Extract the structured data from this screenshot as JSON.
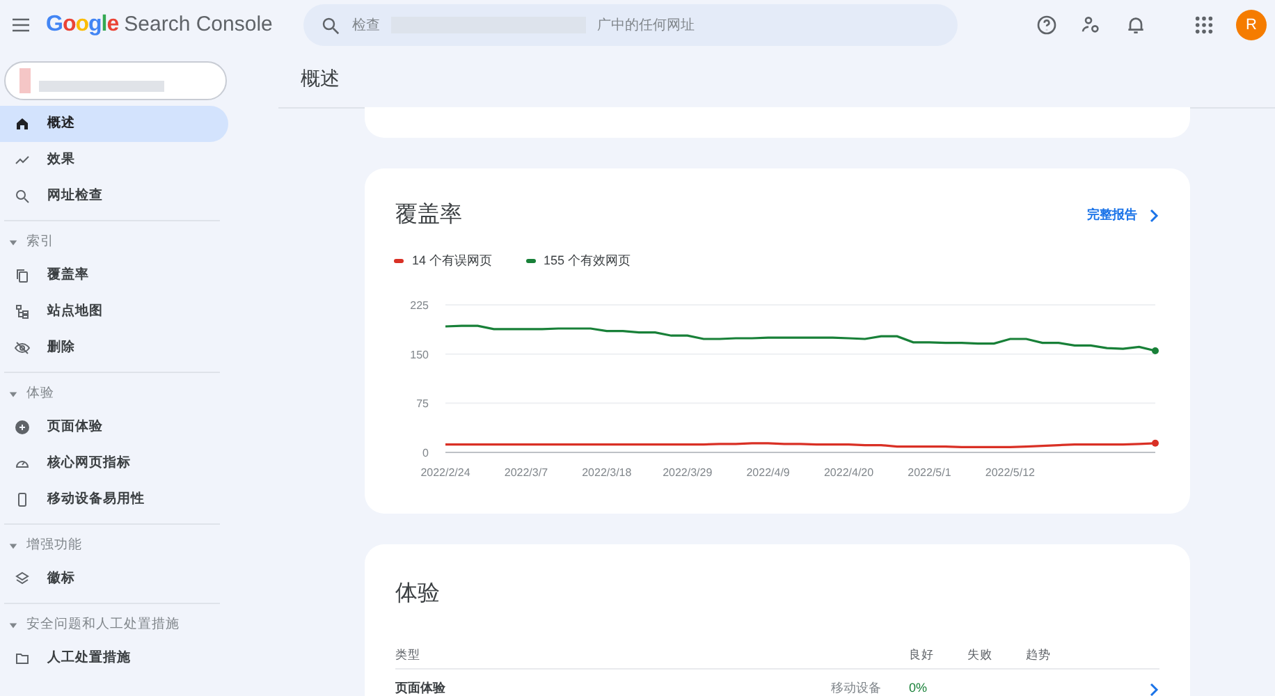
{
  "header": {
    "logo_word": "Google",
    "product": "Search Console",
    "search": {
      "placeholder_start": "检查",
      "placeholder_end": "广中的任何网址"
    },
    "avatar": "R"
  },
  "page_title": "概述",
  "sidebar": [
    {
      "kind": "item",
      "label": "概述",
      "selected": true
    },
    {
      "kind": "item",
      "label": "效果",
      "selected": false
    },
    {
      "kind": "item",
      "label": "网址检查",
      "selected": false
    },
    {
      "kind": "section",
      "label": "索引",
      "expanded": true
    },
    {
      "kind": "item",
      "label": "覆盖率",
      "selected": false
    },
    {
      "kind": "item",
      "label": "站点地图",
      "selected": false
    },
    {
      "kind": "item",
      "label": "删除",
      "selected": false
    },
    {
      "kind": "section",
      "label": "体验",
      "expanded": true
    },
    {
      "kind": "item",
      "label": "页面体验",
      "selected": false
    },
    {
      "kind": "item",
      "label": "核心网页指标",
      "selected": false
    },
    {
      "kind": "item",
      "label": "移动设备易用性",
      "selected": false
    },
    {
      "kind": "section",
      "label": "增强功能",
      "expanded": true
    },
    {
      "kind": "item",
      "label": "徽标",
      "selected": false
    },
    {
      "kind": "section",
      "label": "安全问题和人工处置措施",
      "expanded": true
    },
    {
      "kind": "item",
      "label": "人工处置措施",
      "selected": false
    }
  ],
  "coverage": {
    "title": "覆盖率",
    "link": "完整报告",
    "chart_data": {
      "type": "line",
      "categories": [
        "2022/2/24",
        null,
        null,
        null,
        null,
        "2022/3/7",
        null,
        null,
        null,
        null,
        "2022/3/18",
        null,
        null,
        null,
        null,
        "2022/3/29",
        null,
        null,
        null,
        null,
        "2022/4/9",
        null,
        null,
        null,
        null,
        "2022/4/20",
        null,
        null,
        null,
        null,
        "2022/5/1",
        null,
        null,
        null,
        null,
        "2022/5/12",
        null,
        null,
        null,
        null,
        null,
        null,
        null,
        null,
        null
      ],
      "series": [
        {
          "name": "14 个有误网页",
          "color": "#d93025",
          "values": [
            12,
            12,
            12,
            12,
            12,
            12,
            12,
            12,
            12,
            12,
            12,
            12,
            12,
            12,
            12,
            12,
            12,
            13,
            13,
            14,
            14,
            13,
            13,
            12,
            12,
            12,
            11,
            11,
            9,
            9,
            9,
            9,
            8,
            8,
            8,
            8,
            9,
            10,
            11,
            12,
            12,
            12,
            12,
            13,
            14
          ]
        },
        {
          "name": "155 个有效网页",
          "color": "#188038",
          "values": [
            192,
            193,
            193,
            188,
            188,
            188,
            188,
            189,
            189,
            189,
            185,
            185,
            183,
            183,
            178,
            178,
            173,
            173,
            174,
            174,
            175,
            175,
            175,
            175,
            175,
            174,
            173,
            177,
            177,
            168,
            168,
            167,
            167,
            166,
            166,
            173,
            173,
            167,
            167,
            163,
            163,
            159,
            158,
            161,
            155
          ]
        }
      ],
      "ylim": [
        0,
        225
      ],
      "yticks": [
        0,
        75,
        150,
        225
      ]
    }
  },
  "experience": {
    "title": "体验",
    "columns": [
      "类型",
      "良好",
      "失败",
      "趋势"
    ],
    "rows": [
      {
        "type": "页面体验",
        "device": "移动设备",
        "good": "0%"
      }
    ]
  }
}
